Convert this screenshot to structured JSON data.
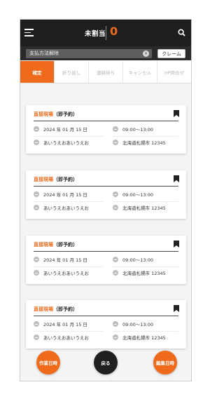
{
  "header": {
    "title": "未割当",
    "count": "0"
  },
  "filter": {
    "value": "支払方法解除",
    "clear_glyph": "×",
    "claim_label": "クレーム"
  },
  "tabs": [
    {
      "label": "確定",
      "active": true
    },
    {
      "label": "折り返し",
      "active": false
    },
    {
      "label": "連絡待ち",
      "active": false
    },
    {
      "label": "キャンセル",
      "active": false
    },
    {
      "label": "HP問合せ",
      "active": false
    }
  ],
  "cards": [
    {
      "type": "直接現場",
      "suffix": "（即予約）",
      "date": "2024 年 01 月 15 日",
      "time": "09:00〜13:00",
      "name": "あいうえおあいうえお",
      "address": "北海道札幌市 12345"
    },
    {
      "type": "直接現場",
      "suffix": "（即予約）",
      "date": "2024 年 01 月 15 日",
      "time": "09:00〜13:00",
      "name": "あいうえおあいうえお",
      "address": "北海道札幌市 12345"
    },
    {
      "type": "直接現場",
      "suffix": "（即予約）",
      "date": "2024 年 01 月 15 日",
      "time": "09:00〜13:00",
      "name": "あいうえおあいうえお",
      "address": "北海道札幌市 12345"
    },
    {
      "type": "直接現場",
      "suffix": "（即予約）",
      "date": "2024 年 01 月 15 日",
      "time": "09:00〜13:00",
      "name": "あいうえおあいうえお",
      "address": "北海道札幌市 12345"
    }
  ],
  "bottom": {
    "work_date": "作業日時",
    "back": "戻る",
    "edit_date": "編集日時"
  },
  "colors": {
    "accent": "#f06a1c",
    "header": "#1e1e1e",
    "filterbar": "#2a2a2a"
  },
  "icons": [
    "menu-icon",
    "search-icon",
    "clear-icon",
    "bookmark-icon",
    "calendar-icon",
    "clock-icon",
    "user-icon",
    "location-icon"
  ]
}
